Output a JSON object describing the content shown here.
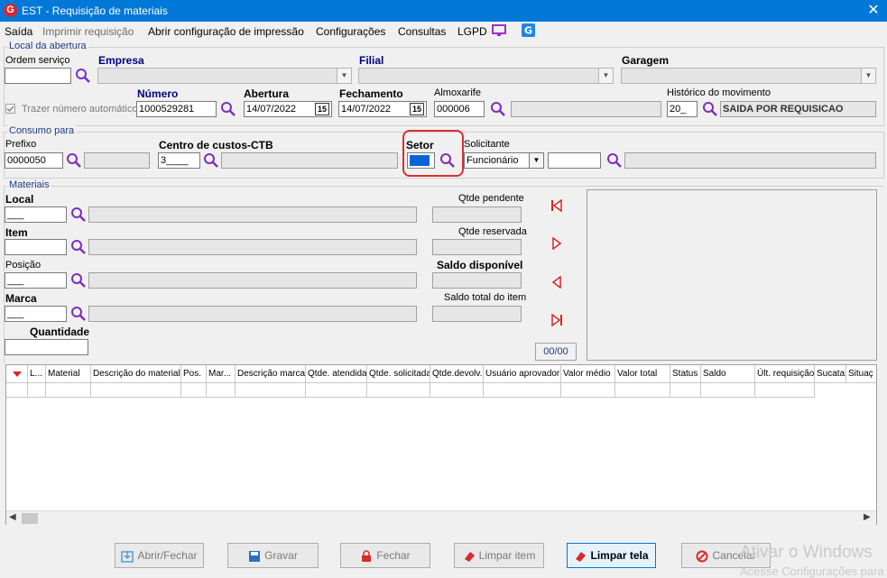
{
  "window": {
    "title": "EST - Requisição de materiais",
    "logo": "G",
    "close": "✕"
  },
  "menu": {
    "saida": "Saída",
    "imprimir": "Imprimir requisição",
    "abrir_config": "Abrir configuração de impressão",
    "configuracoes": "Configurações",
    "consultas": "Consultas",
    "lgpd": "LGPD"
  },
  "local_abertura": {
    "group_label": "Local da abertura",
    "ordem_servico_label": "Ordem serviço",
    "empresa_label": "Empresa",
    "filial_label": "Filial",
    "garagem_label": "Garagem",
    "trazer_numero_label": "Trazer número automático",
    "numero_label": "Número",
    "numero_value": "1000529281",
    "abertura_label": "Abertura",
    "abertura_value": "14/07/2022",
    "fechamento_label": "Fechamento",
    "fechamento_value": "14/07/2022",
    "almoxarife_label": "Almoxarife",
    "almoxarife_value": "000006",
    "historico_label": "Histórico do movimento",
    "historico_code": "20_",
    "historico_desc": "SAIDA POR REQUISICAO",
    "calendar_glyph": "15"
  },
  "consumo": {
    "group_label": "Consumo para",
    "prefixo_label": "Prefixo",
    "prefixo_value": "0000050",
    "centro_label": "Centro de custos-CTB",
    "centro_value": "3____",
    "setor_label": "Setor",
    "solicitante_label": "Solicitante",
    "solicitante_value": "Funcionário"
  },
  "materiais": {
    "group_label": "Materiais",
    "local_label": "Local",
    "local_value": "___",
    "item_label": "Item",
    "posicao_label": "Posição",
    "posicao_value": "___",
    "marca_label": "Marca",
    "marca_value": "___",
    "quantidade_label": "Quantidade",
    "qtde_pendente_label": "Qtde pendente",
    "qtde_reservada_label": "Qtde reservada",
    "saldo_disponivel_label": "Saldo disponível",
    "saldo_total_label": "Saldo total do item",
    "counter": "00/00"
  },
  "grid": {
    "columns": [
      "L...",
      "Material",
      "Descrição do material",
      "Pos.",
      "Mar...",
      "Descrição marca",
      "Qtde. atendida",
      "Qtde. solicitada",
      "Qtde.devolv.",
      "Usuário aprovador",
      "Valor médio",
      "Valor total",
      "Status",
      "Saldo",
      "Últ. requisição",
      "Sucata",
      "Situaç"
    ]
  },
  "buttons": {
    "abrir_fechar": "Abrir/Fechar",
    "gravar": "Gravar",
    "fechar": "Fechar",
    "limpar_item": "Limpar item",
    "limpar_tela": "Limpar tela",
    "cancelar": "Cancelar"
  },
  "watermark": {
    "line1": "Ativar o Windows",
    "line2": "Acesse Configurações para"
  },
  "colors": {
    "titlebar": "#0078d7",
    "accent_purple": "#7b2fbe",
    "nav_red": "#e02020",
    "highlight": "#d93030"
  }
}
